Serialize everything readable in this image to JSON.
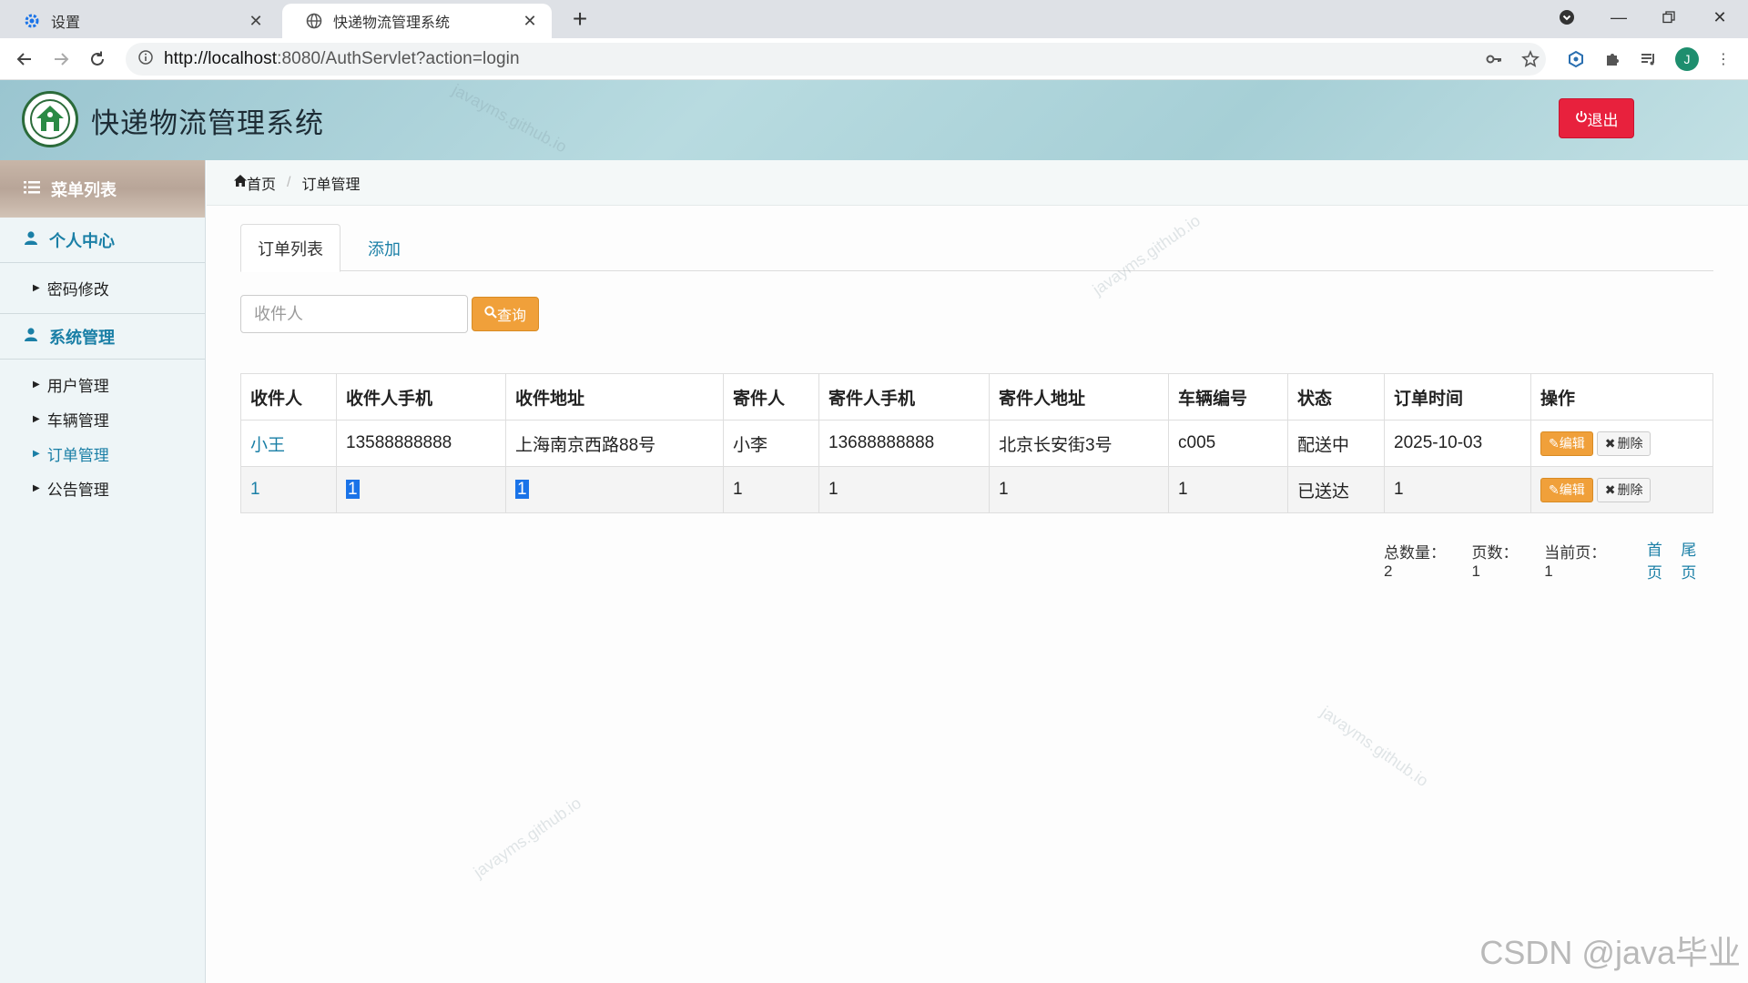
{
  "browser": {
    "tabs": [
      {
        "title": "设置",
        "active": false
      },
      {
        "title": "快递物流管理系统",
        "active": true
      }
    ],
    "url_host": "http://localhost",
    "url_rest": ":8080/AuthServlet?action=login",
    "profile_initial": "J"
  },
  "header": {
    "title": "快递物流管理系统",
    "logout_label": "退出"
  },
  "sidebar": {
    "menu_title": "菜单列表",
    "groups": [
      {
        "label": "个人中心",
        "items": [
          "密码修改"
        ]
      },
      {
        "label": "系统管理",
        "items": [
          "用户管理",
          "车辆管理",
          "订单管理",
          "公告管理"
        ]
      }
    ],
    "active_item": "订单管理"
  },
  "breadcrumb": {
    "home": "首页",
    "current": "订单管理"
  },
  "tabs": {
    "list": "订单列表",
    "add": "添加"
  },
  "search": {
    "placeholder": "收件人",
    "button": "查询"
  },
  "table": {
    "columns": [
      "收件人",
      "收件人手机",
      "收件地址",
      "寄件人",
      "寄件人手机",
      "寄件人地址",
      "车辆编号",
      "状态",
      "订单时间",
      "操作"
    ],
    "rows": [
      [
        "小王",
        "13588888888",
        "上海南京西路88号",
        "小李",
        "13688888888",
        "北京长安街3号",
        "c005",
        "配送中",
        "2025-10-03"
      ],
      [
        "1",
        "1",
        "1",
        "1",
        "1",
        "1",
        "1",
        "已送达",
        "1"
      ]
    ],
    "edit_label": "编辑",
    "delete_label": "删除"
  },
  "pager": {
    "total_label": "总数量：2",
    "pages_label": "页数：1",
    "current_label": "当前页：1",
    "first": "首页",
    "last": "尾页"
  },
  "watermark": "javayms.github.io",
  "csdn_mark": "CSDN @java毕业",
  "colors": {
    "accent": "#1a7fa6",
    "logout": "#e8213d",
    "search_button": "#f0a03a"
  }
}
